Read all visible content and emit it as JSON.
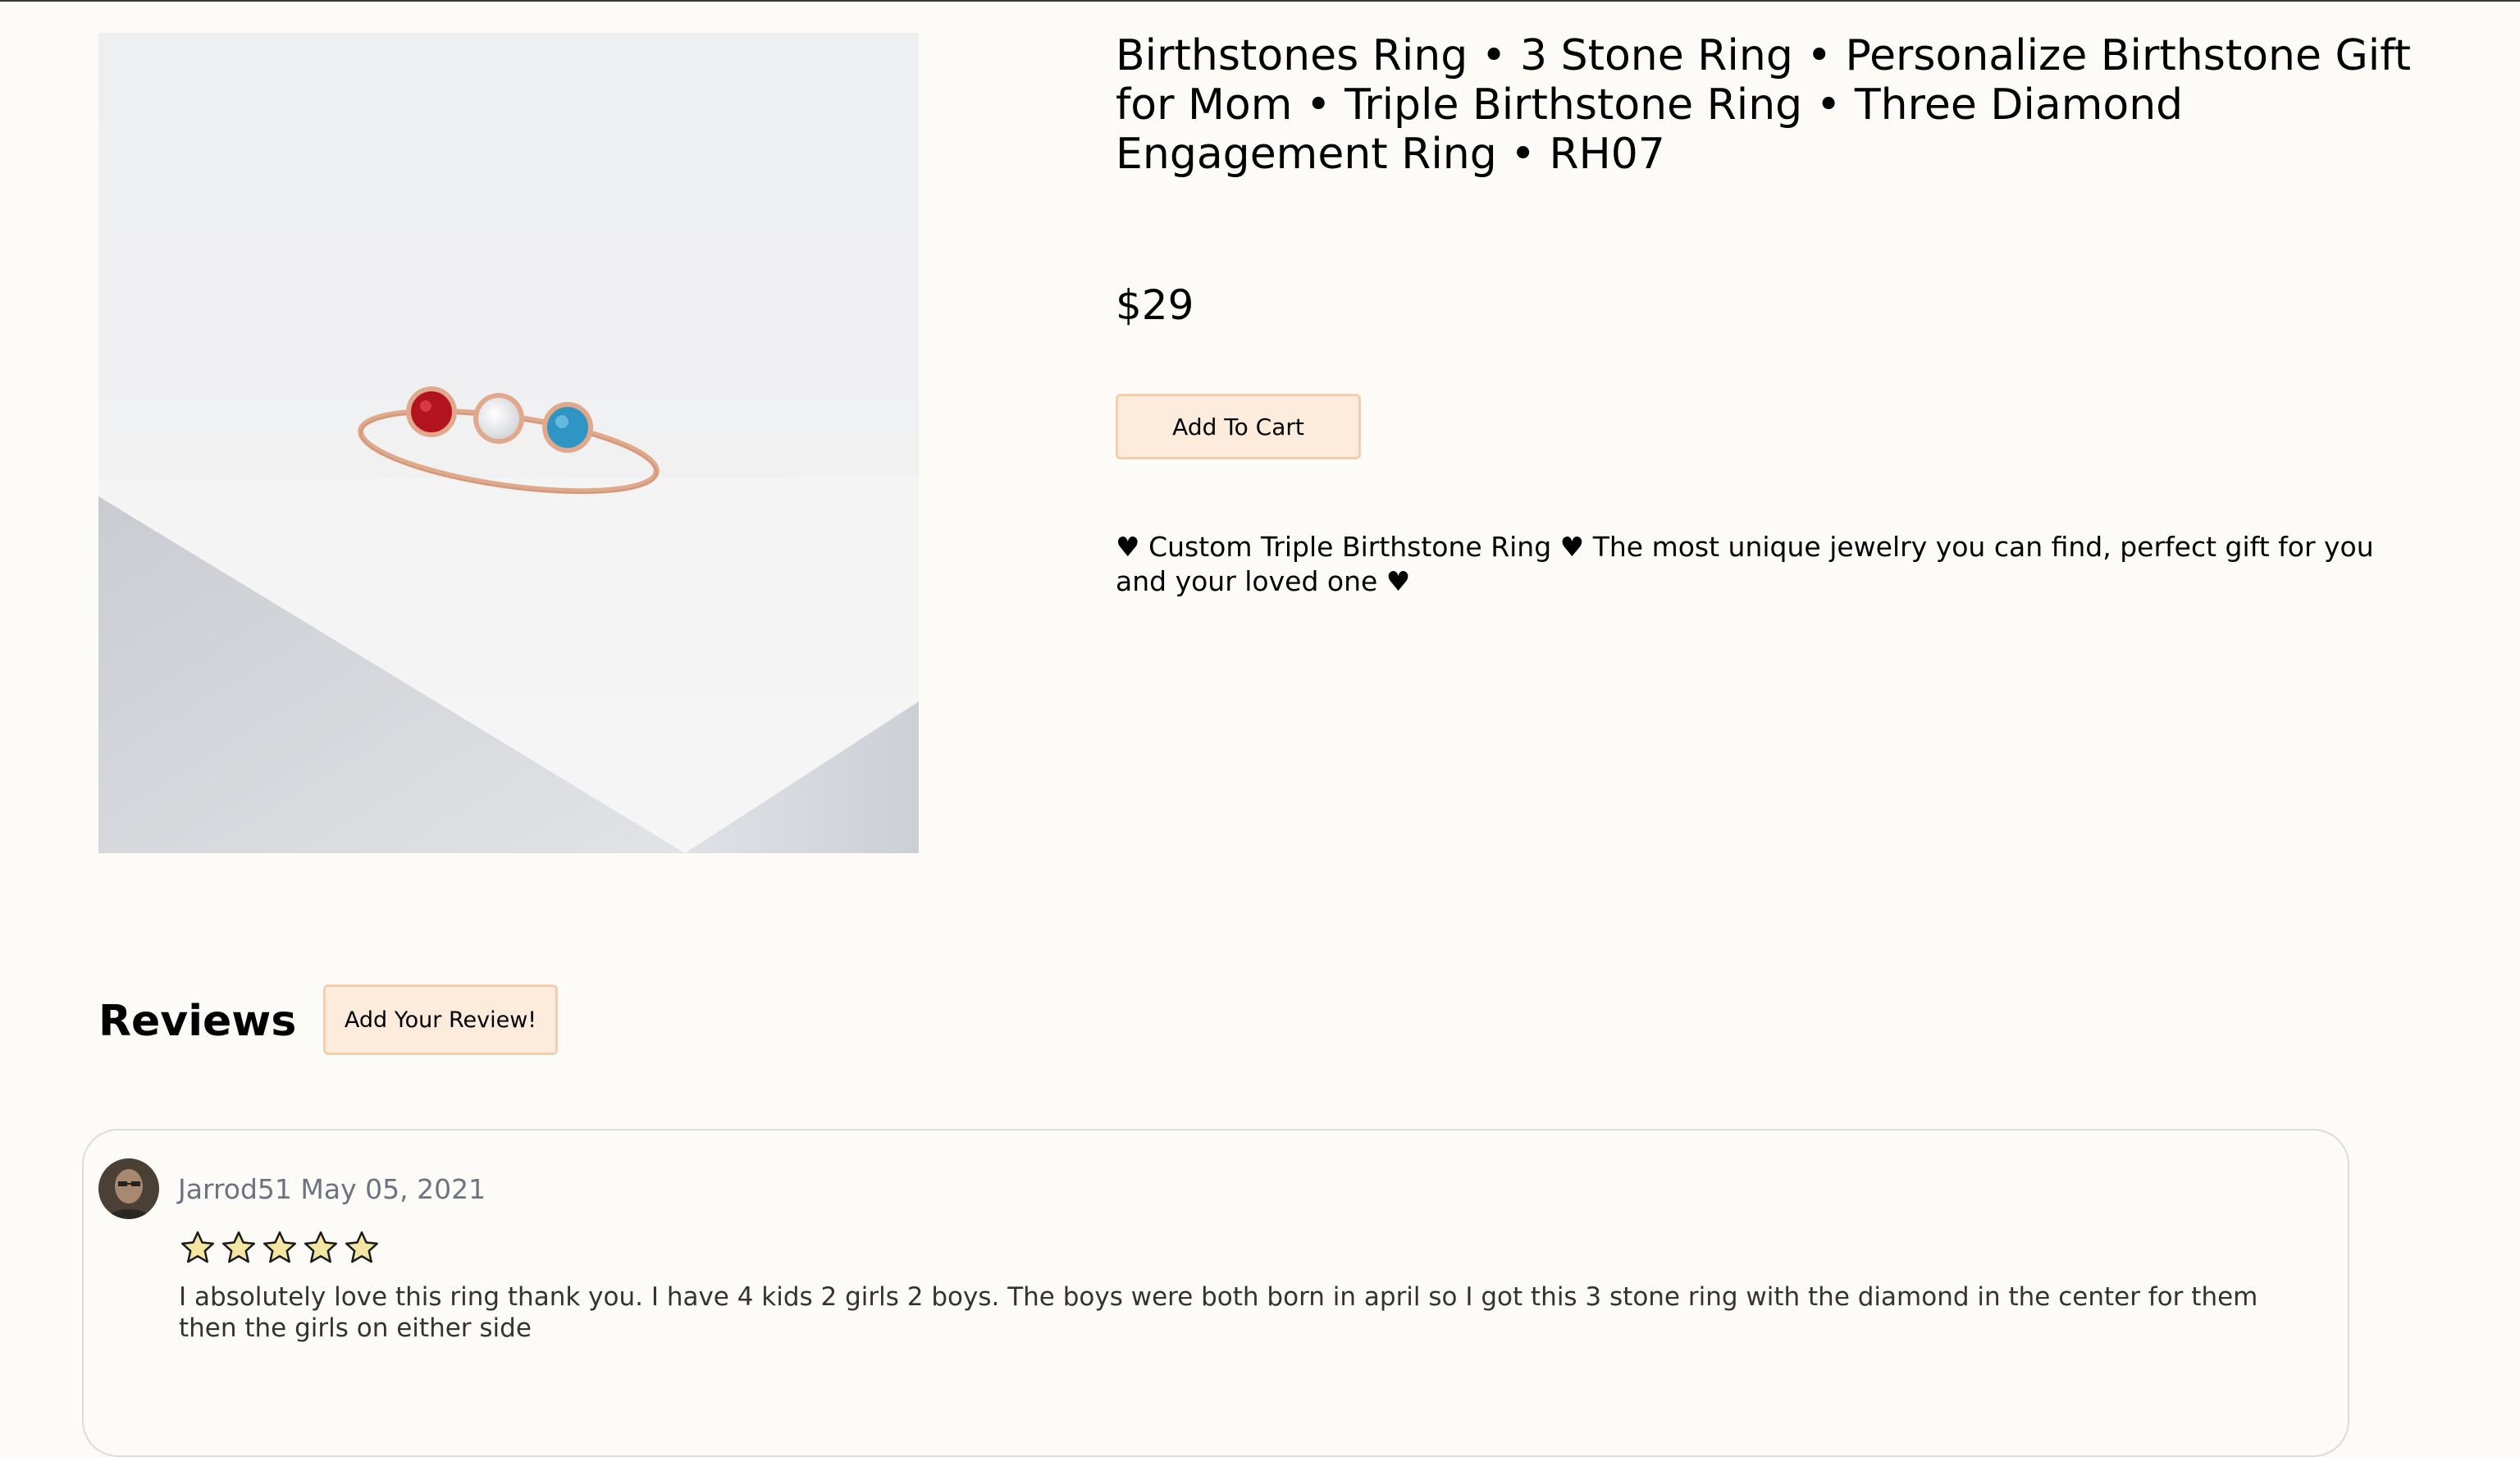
{
  "product": {
    "title": "Birthstones Ring • 3 Stone Ring • Personalize Birthstone Gift for Mom • Triple Birthstone Ring • Three Diamond Engagement Ring • RH07",
    "price": "$29",
    "add_to_cart_label": "Add To Cart",
    "description": "♥ Custom Triple Birthstone Ring ♥ The most unique jewelry you can find, perfect gift for you and your loved one ♥",
    "stone_colors": [
      "#b3121f",
      "#f4f4f6",
      "#2e95c4"
    ],
    "band_color": "#e0a98c"
  },
  "reviews": {
    "heading": "Reviews",
    "add_review_label": "Add Your Review!",
    "items": [
      {
        "author": "Jarrod51",
        "date": "May 05, 2021",
        "rating": 5,
        "rating_max": 5,
        "text": "I absolutely love this ring thank you. I have 4 kids 2 girls 2 boys. The boys were both born in april so I got this 3 stone ring with the diamond in the center for them then the girls on either side"
      }
    ]
  },
  "colors": {
    "page_background": "#fcfbf8",
    "button_background": "#fdebdc",
    "button_border": "#f3cfae",
    "star_fill": "#f3e6a3",
    "meta_text": "#6b7480"
  }
}
